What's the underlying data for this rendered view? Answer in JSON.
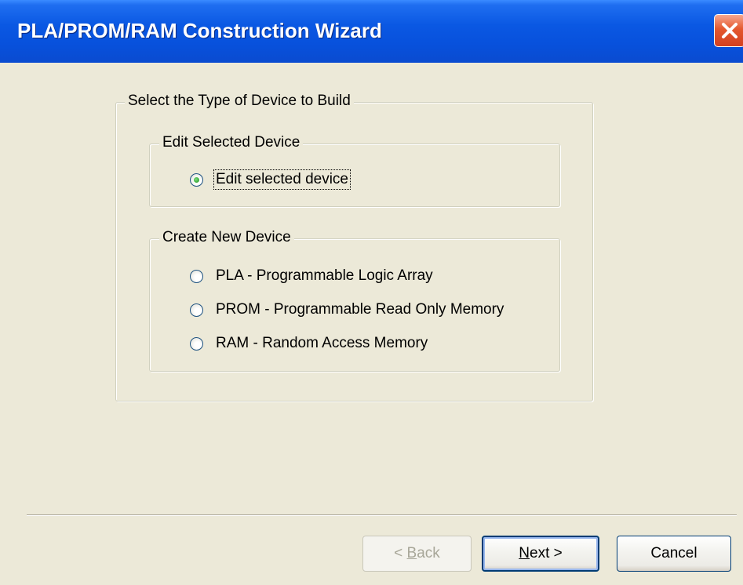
{
  "window": {
    "title": "PLA/PROM/RAM Construction Wizard"
  },
  "device_type_group": {
    "legend": "Select the Type of Device to Build",
    "edit_group": {
      "legend": "Edit Selected Device",
      "options": [
        {
          "label": "Edit selected device",
          "selected": true
        }
      ]
    },
    "create_group": {
      "legend": "Create New Device",
      "options": [
        {
          "label": "PLA - Programmable Logic Array",
          "selected": false
        },
        {
          "label": "PROM - Programmable Read Only Memory",
          "selected": false
        },
        {
          "label": "RAM - Random Access Memory",
          "selected": false
        }
      ]
    }
  },
  "buttons": {
    "back": {
      "mnemonic": "B",
      "rest": "ack",
      "prefix": "< ",
      "enabled": false
    },
    "next": {
      "mnemonic": "N",
      "rest": "ext >",
      "enabled": true
    },
    "cancel": {
      "label": "Cancel",
      "enabled": true
    }
  },
  "colors": {
    "titlebar": "#0a58e3",
    "dialog_bg": "#ece9d8",
    "close": "#e4582e"
  }
}
